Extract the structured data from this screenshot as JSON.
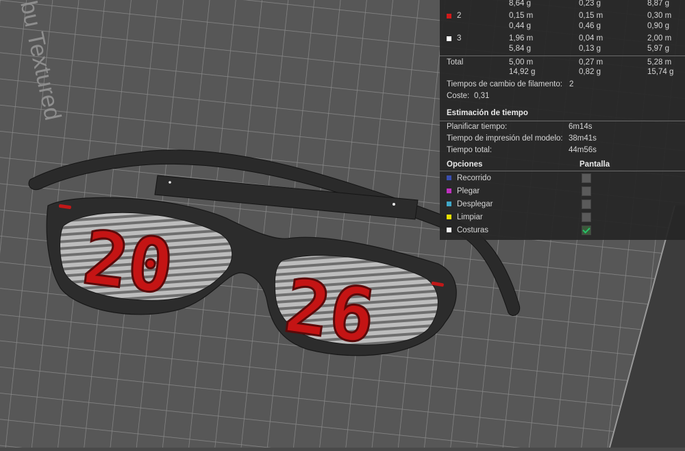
{
  "viewport": {
    "bed_text": "bu Textured",
    "model_digits_left": "20",
    "model_digits_right": "26"
  },
  "filament_table": {
    "rows": [
      {
        "id": "",
        "color": "",
        "a": [
          "8,64 g"
        ],
        "b": [
          "0,23 g"
        ],
        "c": [
          "8,87 g"
        ]
      },
      {
        "id": "2",
        "color": "#d11a1a",
        "a": [
          "0,15 m",
          "0,44 g"
        ],
        "b": [
          "0,15 m",
          "0,46 g"
        ],
        "c": [
          "0,30 m",
          "0,90 g"
        ]
      },
      {
        "id": "3",
        "color": "#ffffff",
        "a": [
          "1,96 m",
          "5,84 g"
        ],
        "b": [
          "0,04 m",
          "0,13 g"
        ],
        "c": [
          "2,00 m",
          "5,97 g"
        ]
      }
    ],
    "total": {
      "label": "Total",
      "a": [
        "5,00 m",
        "14,92 g"
      ],
      "b": [
        "0,27 m",
        "0,82 g"
      ],
      "c": [
        "5,28 m",
        "15,74 g"
      ]
    },
    "filament_changes_label": "Tiempos de cambio de filamento:",
    "filament_changes_value": "2",
    "cost_label": "Coste:",
    "cost_value": "0,31"
  },
  "time_estimate": {
    "heading": "Estimación de tiempo",
    "rows": [
      {
        "label": "Planificar tiempo:",
        "value": "6m14s"
      },
      {
        "label": "Tiempo de impresión del modelo:",
        "value": "38m41s"
      },
      {
        "label": "Tiempo total:",
        "value": "44m56s"
      }
    ]
  },
  "options": {
    "heading_options": "Opciones",
    "heading_display": "Pantalla",
    "items": [
      {
        "label": "Recorrido",
        "color": "#3a4fb0",
        "checked": false
      },
      {
        "label": "Plegar",
        "color": "#c030c0",
        "checked": false
      },
      {
        "label": "Desplegar",
        "color": "#40a8c8",
        "checked": false
      },
      {
        "label": "Limpiar",
        "color": "#e8e000",
        "checked": false
      },
      {
        "label": "Costuras",
        "color": "#f0f0f0",
        "checked": true
      }
    ]
  }
}
